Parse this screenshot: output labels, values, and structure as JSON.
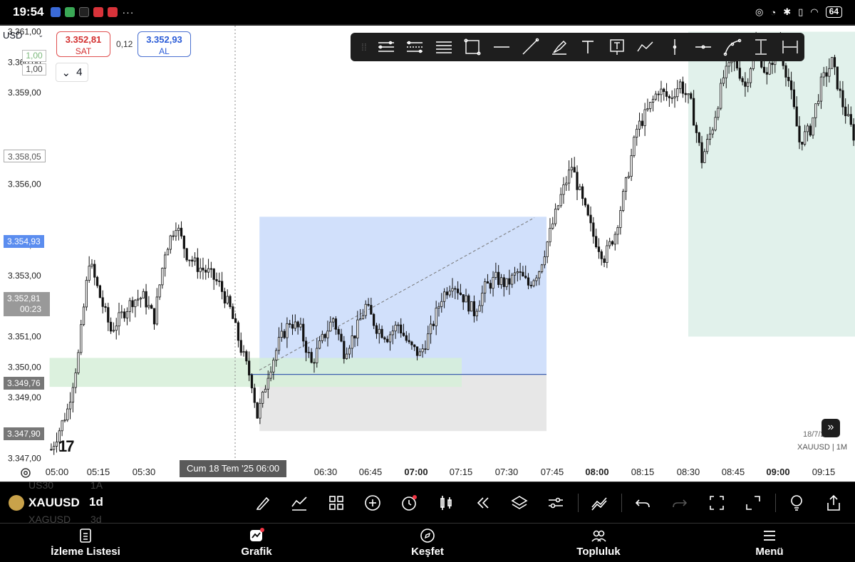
{
  "status_bar": {
    "time": "19:54",
    "more": "···",
    "battery": "64"
  },
  "header": {
    "currency": "USD",
    "sell_price": "3.352,81",
    "sell_label": "SAT",
    "spread": "0,12",
    "buy_price": "3.352,93",
    "buy_label": "AL",
    "lot_a": "1,00",
    "lot_b": "1,00",
    "layer_count": "4"
  },
  "drawing_tools": [
    "pitchfork-icon",
    "parallel-channel-icon",
    "horizontal-lines-icon",
    "rectangle-icon",
    "horizontal-ray-icon",
    "trend-line-icon",
    "brush-icon",
    "text-icon",
    "text-box-icon",
    "path-icon",
    "vertical-line-icon",
    "cross-line-icon",
    "curve-icon",
    "price-range-icon",
    "date-range-icon"
  ],
  "price_tags": {
    "alert_level": "3.358,05",
    "buy_level": "3.354,93",
    "last_price": "3.352,81",
    "countdown": "00:23",
    "sell_level": "3.349,76",
    "low_level": "3.347,90"
  },
  "crosshair": {
    "date_label": "Cum 18 Tem '25   06:00"
  },
  "chart_footer": {
    "date": "18/7/2025",
    "symbol": "XAUUSD | 1M",
    "logo": "17"
  },
  "chart_data": {
    "type": "candlestick",
    "symbol": "XAUUSD",
    "interval": "1M",
    "y_ticks": [
      "3.361,00",
      "3.360,00",
      "3.359,00",
      "3.357,00",
      "3.356,00",
      "3.354,00",
      "3.353,00",
      "3.352,00",
      "3.351,00",
      "3.350,00",
      "3.349,00",
      "3.347,00"
    ],
    "y_tick_values": [
      3361,
      3360,
      3359,
      3357,
      3356,
      3354,
      3353,
      3352,
      3351,
      3350,
      3349,
      3347
    ],
    "x_ticks": [
      "05:00",
      "05:15",
      "05:30",
      "06:00",
      "06:30",
      "06:45",
      "07:00",
      "07:15",
      "07:30",
      "07:45",
      "08:00",
      "08:15",
      "08:30",
      "08:45",
      "09:00",
      "09:15"
    ],
    "x_tick_bold": [
      false,
      false,
      false,
      false,
      false,
      false,
      true,
      false,
      false,
      false,
      true,
      false,
      false,
      false,
      true,
      false
    ],
    "ylim": [
      3346.9,
      3361.2
    ],
    "close_path": [
      [
        0,
        3347.3
      ],
      [
        6,
        3348.6
      ],
      [
        10,
        3350.4
      ],
      [
        14,
        3353.5
      ],
      [
        18,
        3352.3
      ],
      [
        22,
        3351.2
      ],
      [
        26,
        3351.7
      ],
      [
        30,
        3352.2
      ],
      [
        34,
        3352.3
      ],
      [
        38,
        3351.6
      ],
      [
        42,
        3353.8
      ],
      [
        46,
        3354.7
      ],
      [
        50,
        3353.7
      ],
      [
        54,
        3353.3
      ],
      [
        58,
        3353.1
      ],
      [
        62,
        3352.7
      ],
      [
        66,
        3351.9
      ],
      [
        70,
        3350.6
      ],
      [
        74,
        3349.5
      ],
      [
        76,
        3348.4
      ],
      [
        78,
        3349.0
      ],
      [
        80,
        3349.8
      ],
      [
        84,
        3350.8
      ],
      [
        88,
        3351.5
      ],
      [
        92,
        3351.2
      ],
      [
        96,
        3350.1
      ],
      [
        100,
        3350.9
      ],
      [
        104,
        3351.6
      ],
      [
        108,
        3350.5
      ],
      [
        112,
        3351.1
      ],
      [
        116,
        3352.0
      ],
      [
        120,
        3351.3
      ],
      [
        124,
        3351.0
      ],
      [
        128,
        3351.4
      ],
      [
        132,
        3350.7
      ],
      [
        136,
        3350.4
      ],
      [
        140,
        3351.2
      ],
      [
        144,
        3352.3
      ],
      [
        148,
        3352.8
      ],
      [
        152,
        3352.3
      ],
      [
        156,
        3351.8
      ],
      [
        160,
        3352.6
      ],
      [
        164,
        3352.9
      ],
      [
        168,
        3352.7
      ],
      [
        172,
        3353.1
      ],
      [
        176,
        3352.7
      ],
      [
        180,
        3353.2
      ],
      [
        184,
        3354.4
      ],
      [
        188,
        3355.6
      ],
      [
        192,
        3356.6
      ],
      [
        196,
        3355.4
      ],
      [
        200,
        3354.3
      ],
      [
        204,
        3353.6
      ],
      [
        208,
        3354.4
      ],
      [
        212,
        3356.0
      ],
      [
        216,
        3357.8
      ],
      [
        220,
        3358.4
      ],
      [
        224,
        3359.1
      ],
      [
        228,
        3358.8
      ],
      [
        232,
        3359.3
      ],
      [
        236,
        3358.6
      ],
      [
        240,
        3356.8
      ],
      [
        244,
        3357.9
      ],
      [
        248,
        3359.5
      ],
      [
        252,
        3360.1
      ],
      [
        256,
        3359.2
      ],
      [
        260,
        3360.6
      ],
      [
        264,
        3359.5
      ],
      [
        268,
        3360.7
      ],
      [
        272,
        3359.4
      ],
      [
        276,
        3357.4
      ],
      [
        280,
        3357.8
      ],
      [
        284,
        3359.3
      ],
      [
        288,
        3360.0
      ],
      [
        292,
        3358.6
      ],
      [
        296,
        3357.6
      ]
    ],
    "zones": [
      {
        "kind": "long-position-profit",
        "x1": 0.3035,
        "x2": 0.6392,
        "y1": 3354.93,
        "y2": 3349.76,
        "color": "#c9dafa"
      },
      {
        "kind": "long-position-stop",
        "x1": 0.3035,
        "x2": 0.6392,
        "y1": 3349.76,
        "y2": 3347.9,
        "color": "#e3e3e3"
      },
      {
        "kind": "demand-zone",
        "x1": 0.058,
        "x2": 0.54,
        "y1": 3350.3,
        "y2": 3349.35,
        "color": "#d6efd8"
      },
      {
        "kind": "target-zone",
        "x1": 0.805,
        "x2": 1.0,
        "y1": 3361.0,
        "y2": 3351.0,
        "color": "#dcefe8"
      }
    ],
    "entry_line": 3349.76,
    "grid": false
  },
  "bottom_toolbar": {
    "symbol": "XAUUSD",
    "interval": "1d",
    "ghost_above_symbol": "US30",
    "ghost_above_interval": "1A",
    "ghost_below_symbol": "XAGUSD",
    "ghost_below_interval": "3d"
  },
  "nav": [
    {
      "label": "İzleme Listesi",
      "icon": "watchlist-icon"
    },
    {
      "label": "Grafik",
      "icon": "chart-icon"
    },
    {
      "label": "Keşfet",
      "icon": "compass-icon"
    },
    {
      "label": "Topluluk",
      "icon": "community-icon"
    },
    {
      "label": "Menü",
      "icon": "menu-icon"
    }
  ]
}
